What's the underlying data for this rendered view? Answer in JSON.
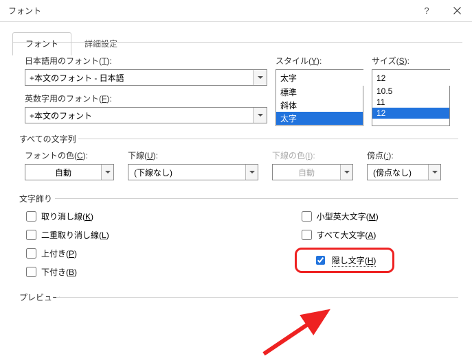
{
  "window": {
    "title": "フォント"
  },
  "tabs": {
    "font": "フォント",
    "advanced": "詳細設定"
  },
  "labels": {
    "jp_font": "日本語用のフォント(",
    "jp_font_k": "T",
    "en_font": "英数字用のフォント(",
    "en_font_k": "F",
    "style": "スタイル(",
    "style_k": "Y",
    "size": "サイズ(",
    "size_k": "S",
    "close": "):"
  },
  "values": {
    "jp_font": "+本文のフォント - 日本語",
    "en_font": "+本文のフォント",
    "style": "太字",
    "size": "12"
  },
  "style_options": [
    "標準",
    "斜体",
    "太字"
  ],
  "size_options": [
    "10.5",
    "11",
    "12"
  ],
  "section_all": "すべての文字列",
  "row2_labels": {
    "color": "フォントの色(",
    "color_k": "C",
    "underline": "下線(",
    "underline_k": "U",
    "uline_color": "下線の色(",
    "uline_color_k": "I",
    "emphasis": "傍点(",
    "emphasis_k": ":"
  },
  "row2_values": {
    "color": "自動",
    "underline": "(下線なし)",
    "uline_color": "自動",
    "emphasis": "(傍点なし)"
  },
  "section_effects": "文字飾り",
  "effects": {
    "strike": "取り消し線(",
    "strike_k": "K",
    "dstrike": "二重取り消し線(",
    "dstrike_k": "L",
    "super": "上付き(",
    "super_k": "P",
    "sub": "下付き(",
    "sub_k": "B",
    "smallcaps": "小型英大文字(",
    "smallcaps_k": "M",
    "allcaps": "すべて大文字(",
    "allcaps_k": "A",
    "hidden": "隠し文字(",
    "hidden_k": "H",
    "close": ")"
  },
  "section_preview": "プレビュー"
}
